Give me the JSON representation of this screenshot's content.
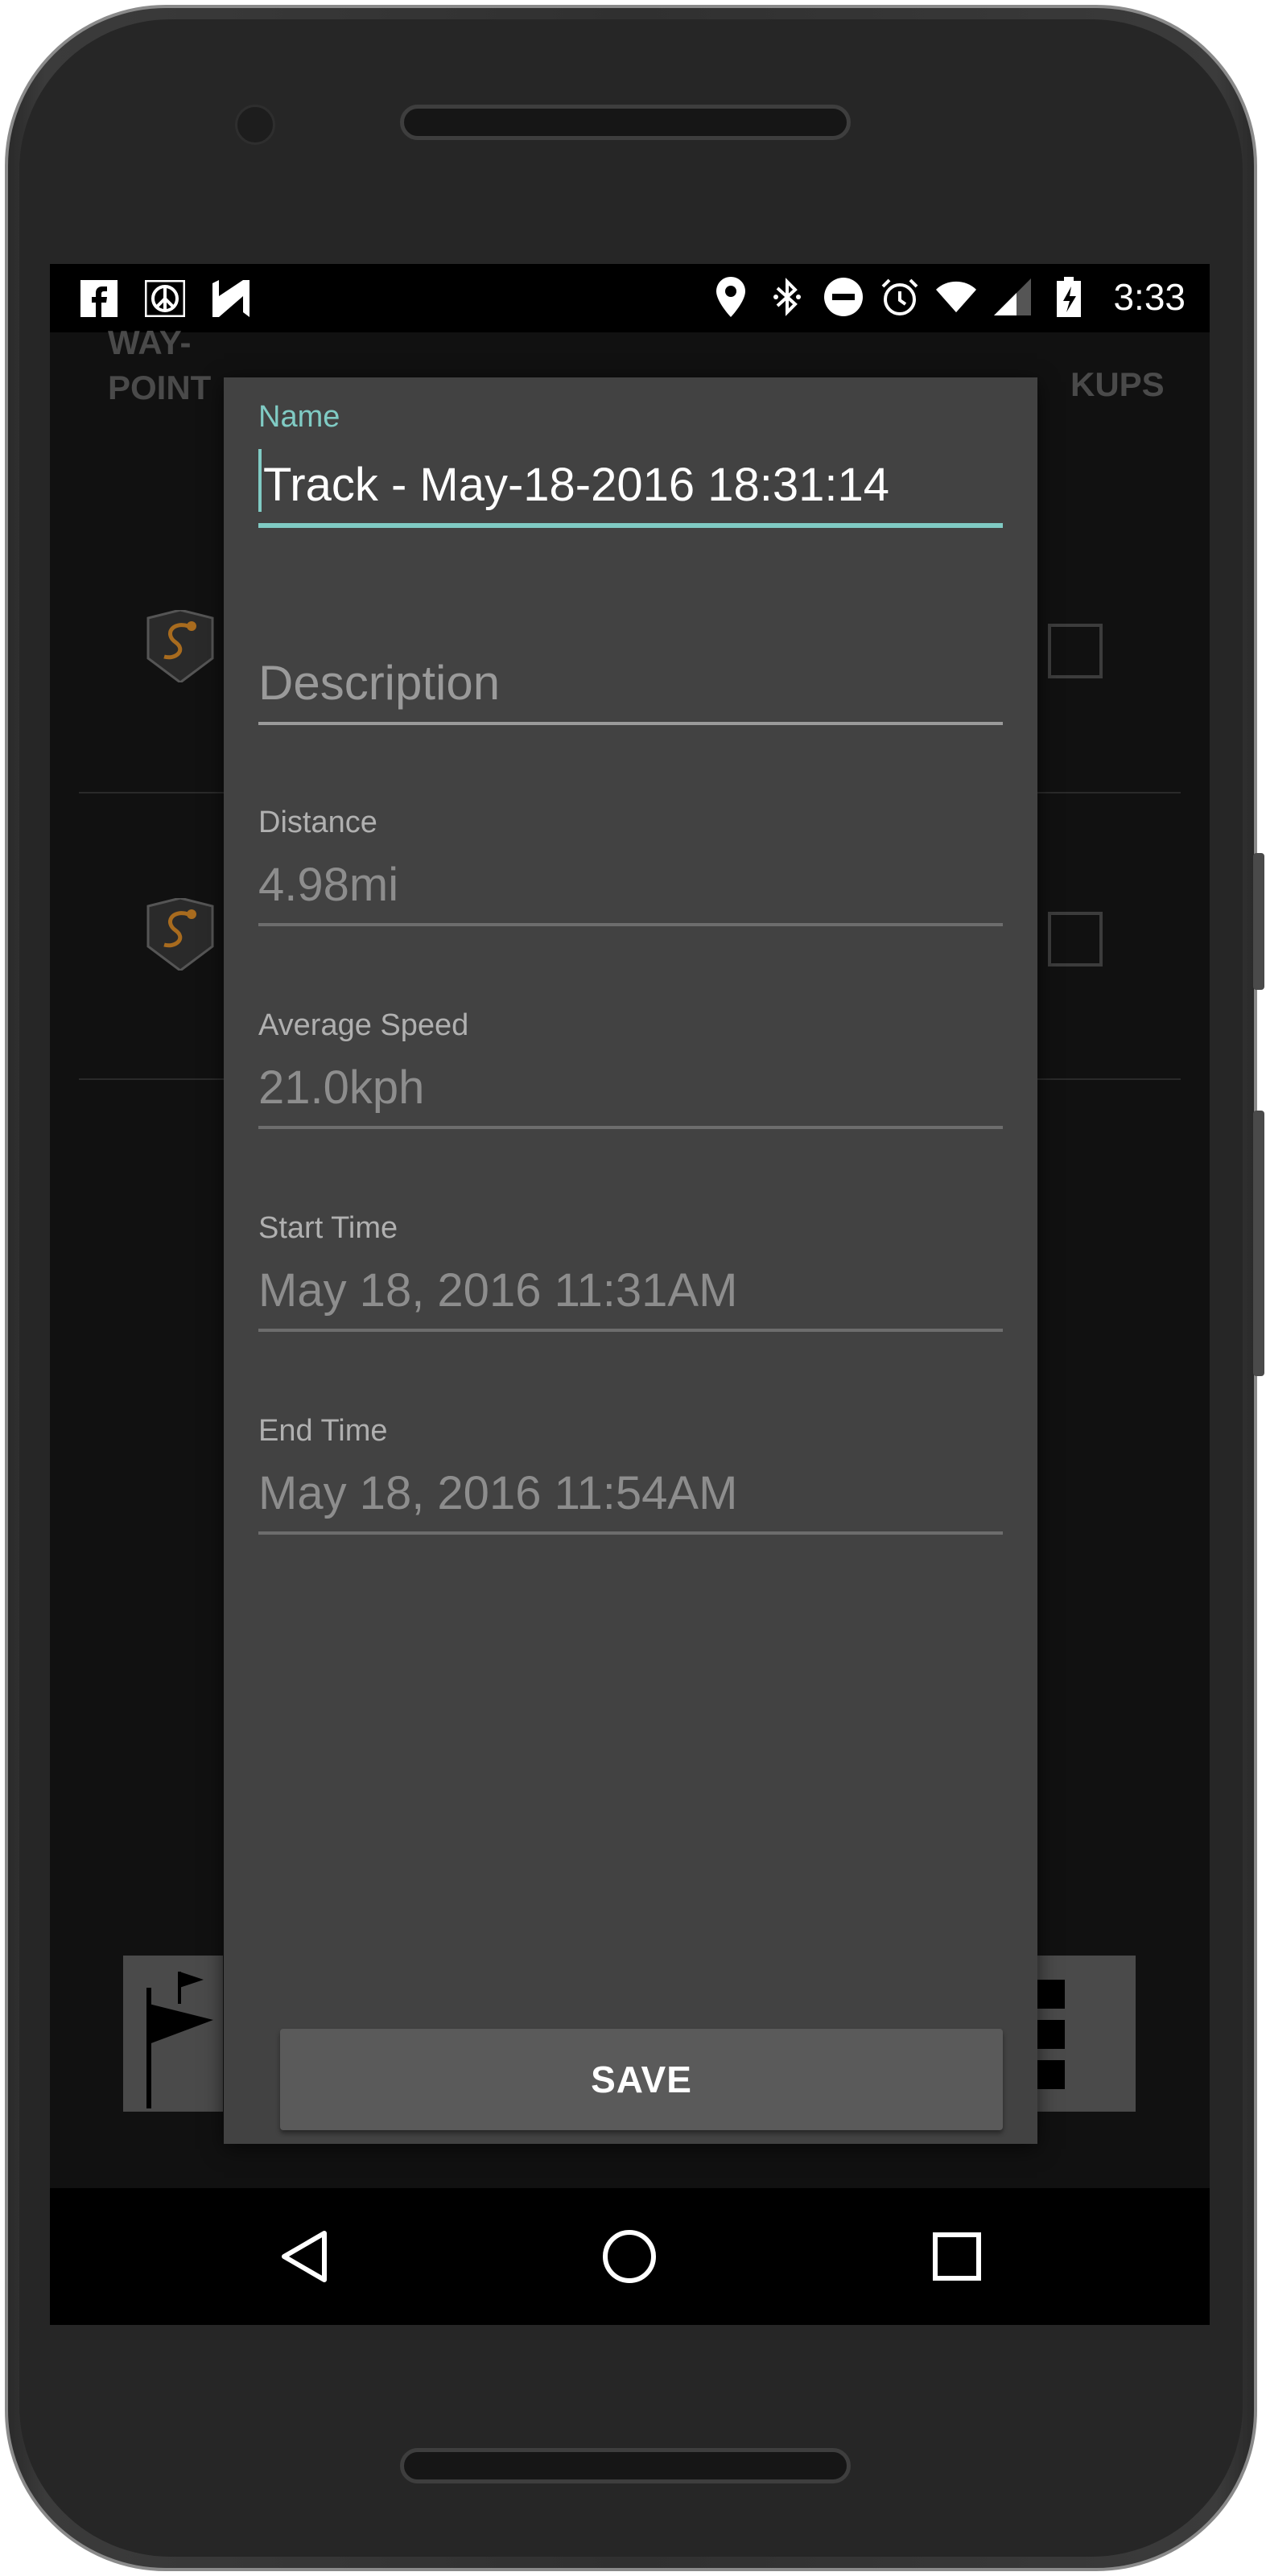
{
  "status_bar": {
    "left_icons": [
      "facebook-icon",
      "peace-icon",
      "n-icon"
    ],
    "right_icons": [
      "location-icon",
      "bluetooth-icon",
      "do-not-disturb-icon",
      "alarm-icon",
      "wifi-icon",
      "signal-icon",
      "battery-charging-icon"
    ],
    "time": "3:33"
  },
  "background_app": {
    "tab_left": "WAY-\nPOINTS",
    "tab_left_line1": "WAY-",
    "tab_left_line2": "POINT",
    "tab_right": "KUPS"
  },
  "dialog": {
    "name_label": "Name",
    "name_value": "Track - May-18-2016 18:31:14",
    "description_placeholder": "Description",
    "distance_label": "Distance",
    "distance_value": "4.98mi",
    "avg_speed_label": "Average Speed",
    "avg_speed_value": "21.0kph",
    "start_time_label": "Start Time",
    "start_time_value": "May 18, 2016 11:31AM",
    "end_time_label": "End Time",
    "end_time_value": "May 18, 2016 11:54AM",
    "save_label": "SAVE"
  },
  "nav_bar": {
    "back": "back-icon",
    "home": "home-icon",
    "recents": "recents-icon"
  },
  "colors": {
    "accent": "#80cbc4",
    "dialog_bg": "#424242",
    "screen_bg": "#111111"
  }
}
